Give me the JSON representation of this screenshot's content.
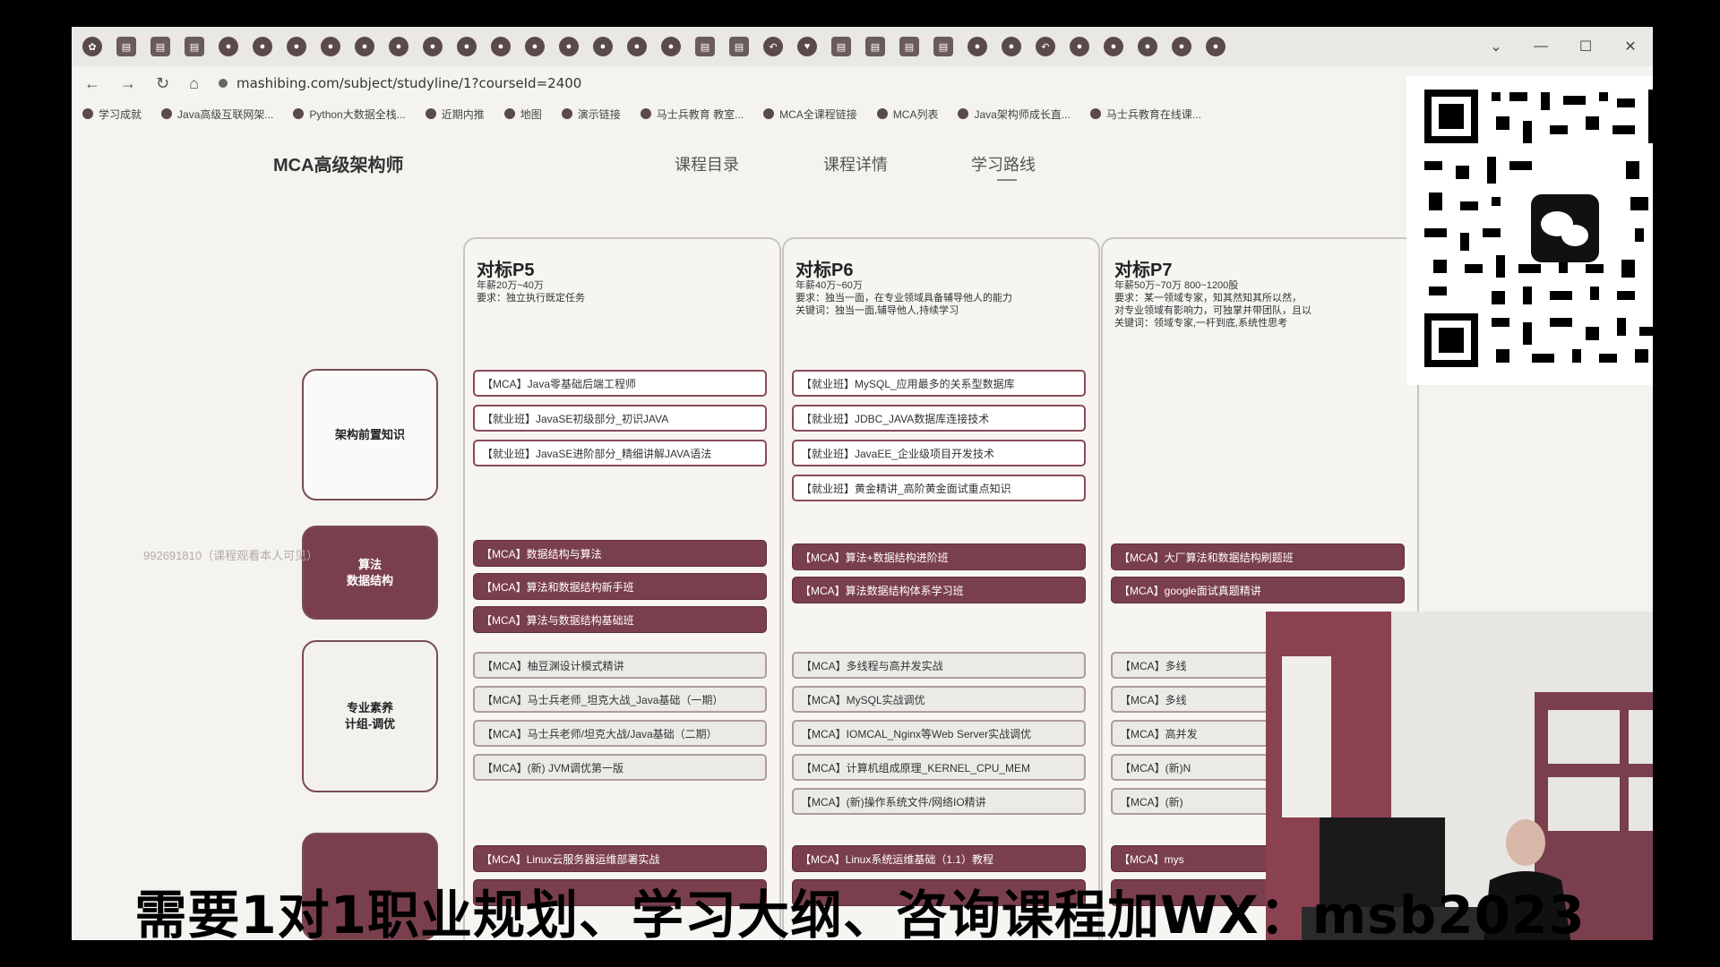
{
  "browser": {
    "url": "mashibing.com/subject/studyline/1?courseId=2400",
    "window_controls": [
      "⌄",
      "—",
      "☐",
      "✕"
    ],
    "bookmarks": [
      "学习成就",
      "Java高级互联网架...",
      "Python大数据全栈...",
      "近期内推",
      "地图",
      "演示链接",
      "马士兵教育 教室...",
      "MCA全课程链接",
      "MCA列表",
      "Java架构师成长直...",
      "马士兵教育在线课..."
    ]
  },
  "site": {
    "title": "MCA高级架构师",
    "nav": [
      "课程目录",
      "课程详情",
      "学习路线"
    ]
  },
  "columns": [
    {
      "heading": "对标P5",
      "lines": [
        "年薪20万~40万",
        "要求：独立执行既定任务"
      ]
    },
    {
      "heading": "对标P6",
      "lines": [
        "年薪40万~60万",
        "要求：独当一面，在专业领域具备辅导他人的能力",
        "关键词：独当一面,辅导他人,持续学习"
      ]
    },
    {
      "heading": "对标P7",
      "lines": [
        "年薪50万~70万 800~1200股",
        "要求：某一领域专家，知其然知其所以然，",
        "对专业领域有影响力，可独掌并带团队，且以",
        "关键词：领域专家,一杆到底,系统性思考"
      ]
    }
  ],
  "categories": [
    {
      "label": "架构前置知识"
    },
    {
      "label": "算法\n数据结构"
    },
    {
      "label": "专业素养\n计组-调优"
    }
  ],
  "items": {
    "p5_pre": [
      "【MCA】Java零基础后端工程师",
      "【就业班】JavaSE初级部分_初识JAVA",
      "【就业班】JavaSE进阶部分_精细讲解JAVA语法"
    ],
    "p6_pre": [
      "【就业班】MySQL_应用最多的关系型数据库",
      "【就业班】JDBC_JAVA数据库连接技术",
      "【就业班】JavaEE_企业级项目开发技术",
      "【就业班】黄金精讲_高阶黄金面试重点知识"
    ],
    "p5_algo": [
      "【MCA】数据结构与算法",
      "【MCA】算法和数据结构新手班",
      "【MCA】算法与数据结构基础班"
    ],
    "p6_algo": [
      "【MCA】算法+数据结构进阶班",
      "【MCA】算法数据结构体系学习班"
    ],
    "p7_algo": [
      "【MCA】大厂算法和数据结构刷题班",
      "【MCA】google面试真题精讲"
    ],
    "p5_pro": [
      "【MCA】柚豆渊设计模式精讲",
      "【MCA】马士兵老师_坦克大战_Java基础（一期）",
      "【MCA】马士兵老师/坦克大战/Java基础（二期）",
      "【MCA】(新) JVM调优第一版"
    ],
    "p6_pro": [
      "【MCA】多线程与高并发实战",
      "【MCA】MySQL实战调优",
      "【MCA】IOMCAL_Nginx等Web Server实战调优",
      "【MCA】计算机组成原理_KERNEL_CPU_MEM",
      "【MCA】(新)操作系统文件/网络IO精讲"
    ],
    "p7_pro": [
      "【MCA】多线",
      "【MCA】多线",
      "【MCA】高并发",
      "【MCA】(新)N",
      "【MCA】(新)"
    ],
    "p5_next": [
      "【MCA】Linux云服务器运维部署实战"
    ],
    "p6_next": [
      "【MCA】Linux系统运维基础（1.1）教程"
    ],
    "p7_next": [
      "【MCA】mys"
    ]
  },
  "watermark_id": "992691810（课程观看本人可见）",
  "caption": "需要1对1职业规划、学习大纲、咨询课程加WX：msb2023",
  "colors": {
    "accent": "#7a3f4c",
    "page_bg": "#f4f3ef"
  }
}
